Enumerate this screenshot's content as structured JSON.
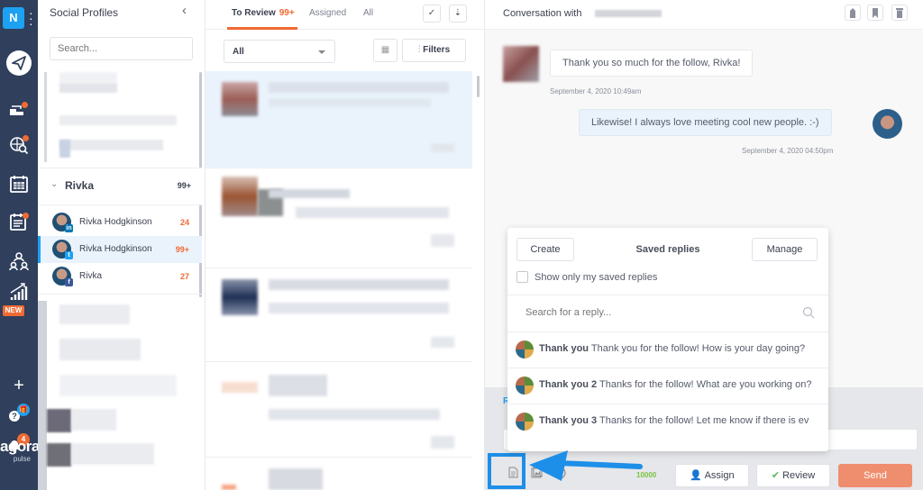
{
  "rail": {
    "workspace_initial": "N",
    "menu_icon": "kebab-dots",
    "items": [
      {
        "icon": "send-icon",
        "label": "Publishing"
      },
      {
        "icon": "inbox-icon",
        "label": "Inbox"
      },
      {
        "icon": "listening-icon",
        "label": "Listening"
      },
      {
        "icon": "calendar-icon",
        "label": "Calendar"
      },
      {
        "icon": "schedule-icon",
        "label": "Scheduled"
      },
      {
        "icon": "team-icon",
        "label": "Team"
      },
      {
        "icon": "reports-icon",
        "label": "Reports",
        "badge": "NEW"
      }
    ],
    "add_icon": "+",
    "help_icon": "?",
    "notifications_count": "4",
    "logo_text": "agora",
    "logo_sub": "pulse"
  },
  "profiles": {
    "title": "Social Profiles",
    "collapse_icon": "‹",
    "search_placeholder": "Search...",
    "group": {
      "name": "Rivka",
      "count": "99+",
      "chevron": "⌄"
    },
    "items": [
      {
        "name": "Rivka Hodgkinson",
        "network": "in",
        "network_color": "#0077b5",
        "count": "24",
        "active": false
      },
      {
        "name": "Rivka Hodgkinson",
        "network": "t",
        "network_color": "#1da1f2",
        "count": "99+",
        "active": true
      },
      {
        "name": "Rivka",
        "network": "f",
        "network_color": "#3b5998",
        "count": "27",
        "active": false
      }
    ]
  },
  "inbox": {
    "tabs": [
      {
        "label": "To Review",
        "badge": "99+",
        "active": true
      },
      {
        "label": "Assigned",
        "active": false
      },
      {
        "label": "All",
        "active": false
      }
    ],
    "check_icon": "✓",
    "sort_icon": "⇣",
    "filter_select": "All",
    "calendar_icon": "▦",
    "filters_label": "Filters",
    "filters_icon": "⫶"
  },
  "conversation": {
    "title": "Conversation with",
    "header_icons": [
      "tag-icon",
      "bookmark-icon",
      "trash-icon"
    ],
    "messages": [
      {
        "text": "Thank you so much for the follow, Rivka!",
        "timestamp": "September 4, 2020 10:49am",
        "mine": false
      },
      {
        "text": "Likewise! I always love meeting cool new people. :-)",
        "timestamp": "September 4, 2020 04:50pm",
        "mine": true
      }
    ]
  },
  "saved_replies": {
    "title": "Saved replies",
    "create_label": "Create",
    "manage_label": "Manage",
    "only_mine_label": "Show only my saved replies",
    "only_mine_checked": false,
    "search_placeholder": "Search for a reply...",
    "items": [
      {
        "name": "Thank you",
        "text": "Thank you for the follow! How is your day going?"
      },
      {
        "name": "Thank you 2",
        "text": "Thanks for the follow! What are you working on?"
      },
      {
        "name": "Thank you 3",
        "text": "Thanks for the follow! Let me know if there is ev"
      }
    ]
  },
  "composer": {
    "reply_link": "R",
    "char_counter": "10000",
    "assign_label": "Assign",
    "review_label": "Review",
    "send_label": "Send",
    "accent_color": "#f06a33",
    "highlight_color": "#1d8fe8"
  }
}
